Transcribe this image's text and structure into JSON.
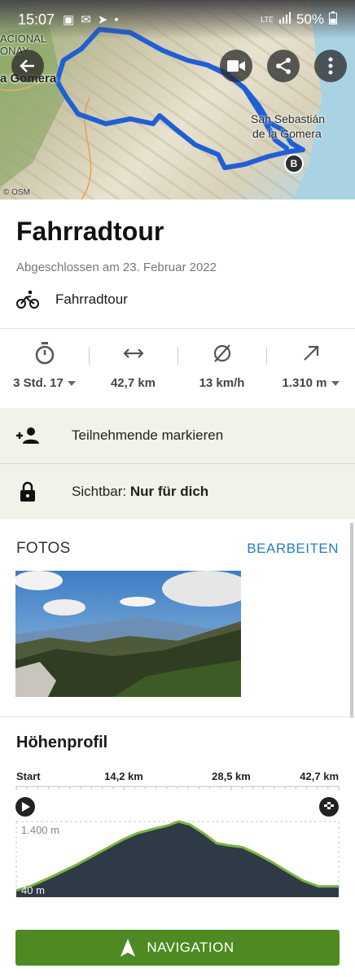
{
  "status_bar": {
    "time": "15:07",
    "network": "LTE",
    "battery": "50%"
  },
  "map": {
    "labels": {
      "nacional": "ACIONAL",
      "garajonay": "ONAY",
      "gomera_west": "a Gomera",
      "san_sebastian_1": "San Sebastián",
      "san_sebastian_2": "de la Gomera"
    },
    "end_marker": "B",
    "attribution": "© OSM",
    "route_color": "#1f5fd6"
  },
  "tour": {
    "title": "Fahrradtour",
    "completed": "Abgeschlossen am 23. Februar 2022",
    "sport": "Fahrradtour"
  },
  "stats": [
    {
      "icon": "stopwatch-icon",
      "value": "3 Std. 17",
      "dropdown": true
    },
    {
      "icon": "distance-icon",
      "value": "42,7 km",
      "dropdown": false
    },
    {
      "icon": "average-speed-icon",
      "value": "13 km/h",
      "dropdown": false
    },
    {
      "icon": "elevation-up-icon",
      "value": "1.310 m",
      "dropdown": true
    }
  ],
  "actions": {
    "mark_participants": "Teilnehmende markieren",
    "visibility_label": "Sichtbar:",
    "visibility_value": "Nur für dich"
  },
  "photos": {
    "heading": "FOTOS",
    "edit": "BEARBEITEN"
  },
  "elevation": {
    "title": "Höhenprofil",
    "distance_ticks": [
      "Start",
      "14,2 km",
      "28,5 km",
      "42,7 km"
    ],
    "max_label": "1.400 m",
    "min_label": "40 m"
  },
  "chart_data": {
    "type": "area",
    "title": "Höhenprofil",
    "xlabel": "",
    "ylabel": "",
    "x": [
      0,
      2,
      4,
      6,
      8,
      10,
      12,
      14,
      16,
      18,
      20,
      21.5,
      23,
      25,
      26.5,
      28,
      30,
      32,
      34,
      36,
      38,
      40,
      42.7
    ],
    "y": [
      60,
      150,
      280,
      420,
      560,
      720,
      880,
      1040,
      1170,
      1250,
      1320,
      1400,
      1340,
      1150,
      980,
      940,
      900,
      760,
      600,
      420,
      250,
      140,
      140
    ],
    "xlim": [
      0,
      42.7
    ],
    "ylim": [
      40,
      1400
    ],
    "grid": false,
    "fill_color": "#2f3a47",
    "line_color": "#7cb342"
  },
  "navigation": {
    "label": "NAVIGATION",
    "color": "#4d8a22"
  }
}
